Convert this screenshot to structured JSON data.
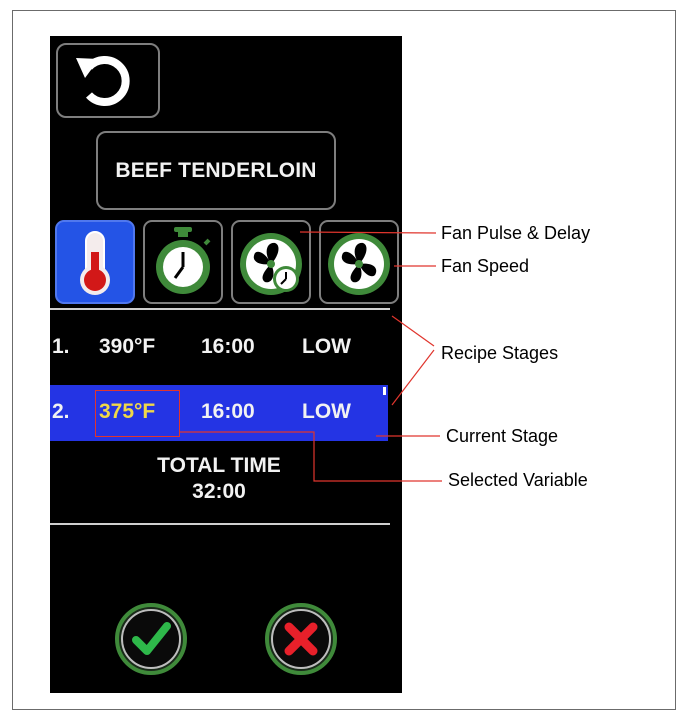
{
  "header": {
    "back_icon": "refresh-icon",
    "recipe_name": "BEEF TENDERLOIN"
  },
  "tabs": [
    {
      "icon": "thermometer-icon",
      "active": true
    },
    {
      "icon": "stopwatch-icon",
      "active": false
    },
    {
      "icon": "fan-pulse-delay-icon",
      "active": false
    },
    {
      "icon": "fan-icon",
      "active": false
    }
  ],
  "stages": [
    {
      "number": "1.",
      "temperature": "390°F",
      "time": "16:00",
      "fan_speed": "LOW",
      "current": false
    },
    {
      "number": "2.",
      "temperature": "375°F",
      "time": "16:00",
      "fan_speed": "LOW",
      "current": true
    }
  ],
  "total": {
    "label": "TOTAL TIME",
    "value": "32:00"
  },
  "actions": {
    "confirm_icon": "check-icon",
    "cancel_icon": "x-icon"
  },
  "callouts": {
    "fan_pulse_delay": "Fan Pulse & Delay",
    "fan_speed": "Fan Speed",
    "recipe_stages": "Recipe Stages",
    "current_stage": "Current Stage",
    "selected_variable": "Selected Variable"
  },
  "colors": {
    "active_tab": "#2454e6",
    "current_stage": "#2434e4",
    "selected_value": "#f0d848",
    "selection_box": "#e0352d",
    "confirm": "#2eb84a",
    "cancel": "#e8202a",
    "icon_ring": "#3f8a3a"
  }
}
